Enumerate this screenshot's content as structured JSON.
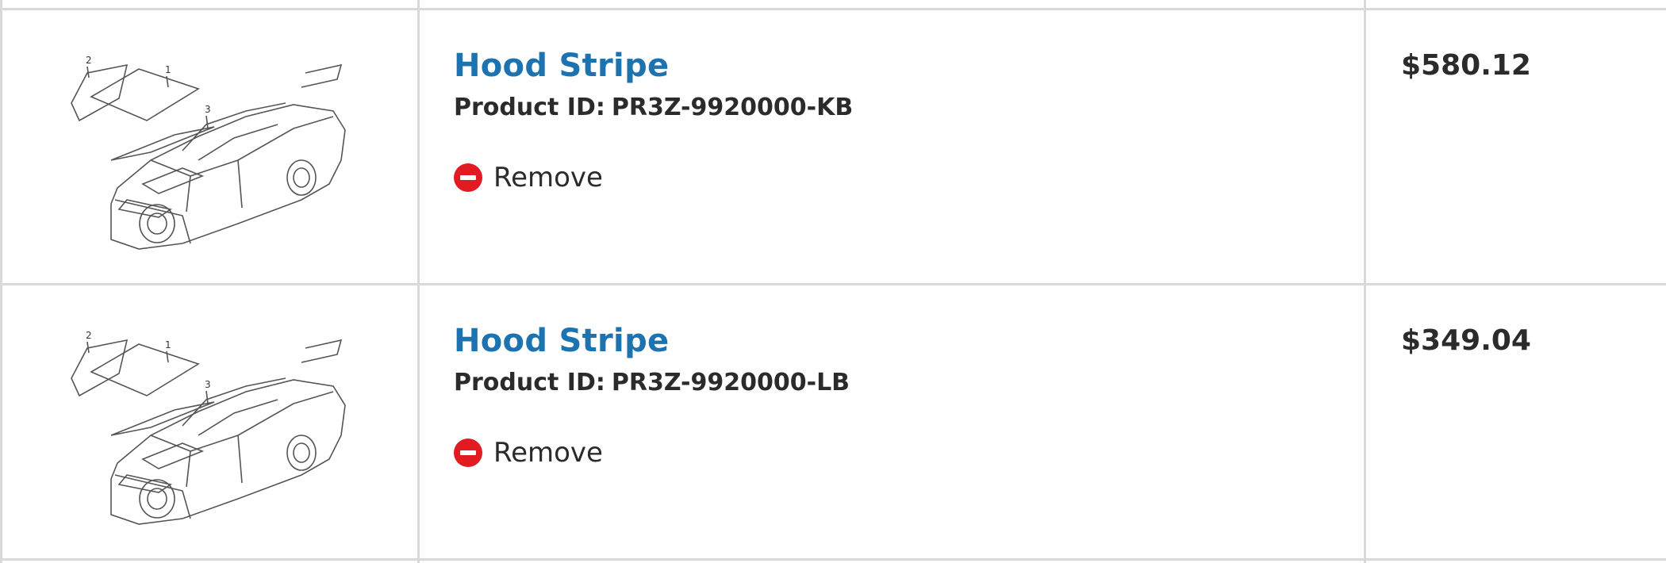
{
  "cart": {
    "items": [
      {
        "title": "Hood Stripe",
        "product_id_label": "Product ID:",
        "product_id": "PR3Z-9920000-KB",
        "remove_label": "Remove",
        "price": "$580.12",
        "image_icon": "car-hood-stripe-diagram"
      },
      {
        "title": "Hood Stripe",
        "product_id_label": "Product ID:",
        "product_id": "PR3Z-9920000-LB",
        "remove_label": "Remove",
        "price": "$349.04",
        "image_icon": "car-hood-stripe-diagram"
      }
    ]
  },
  "colors": {
    "title_link": "#1d72b0",
    "remove_icon": "#e21b23",
    "grid_line": "#d9d9d9",
    "text": "#2b2b2b"
  }
}
